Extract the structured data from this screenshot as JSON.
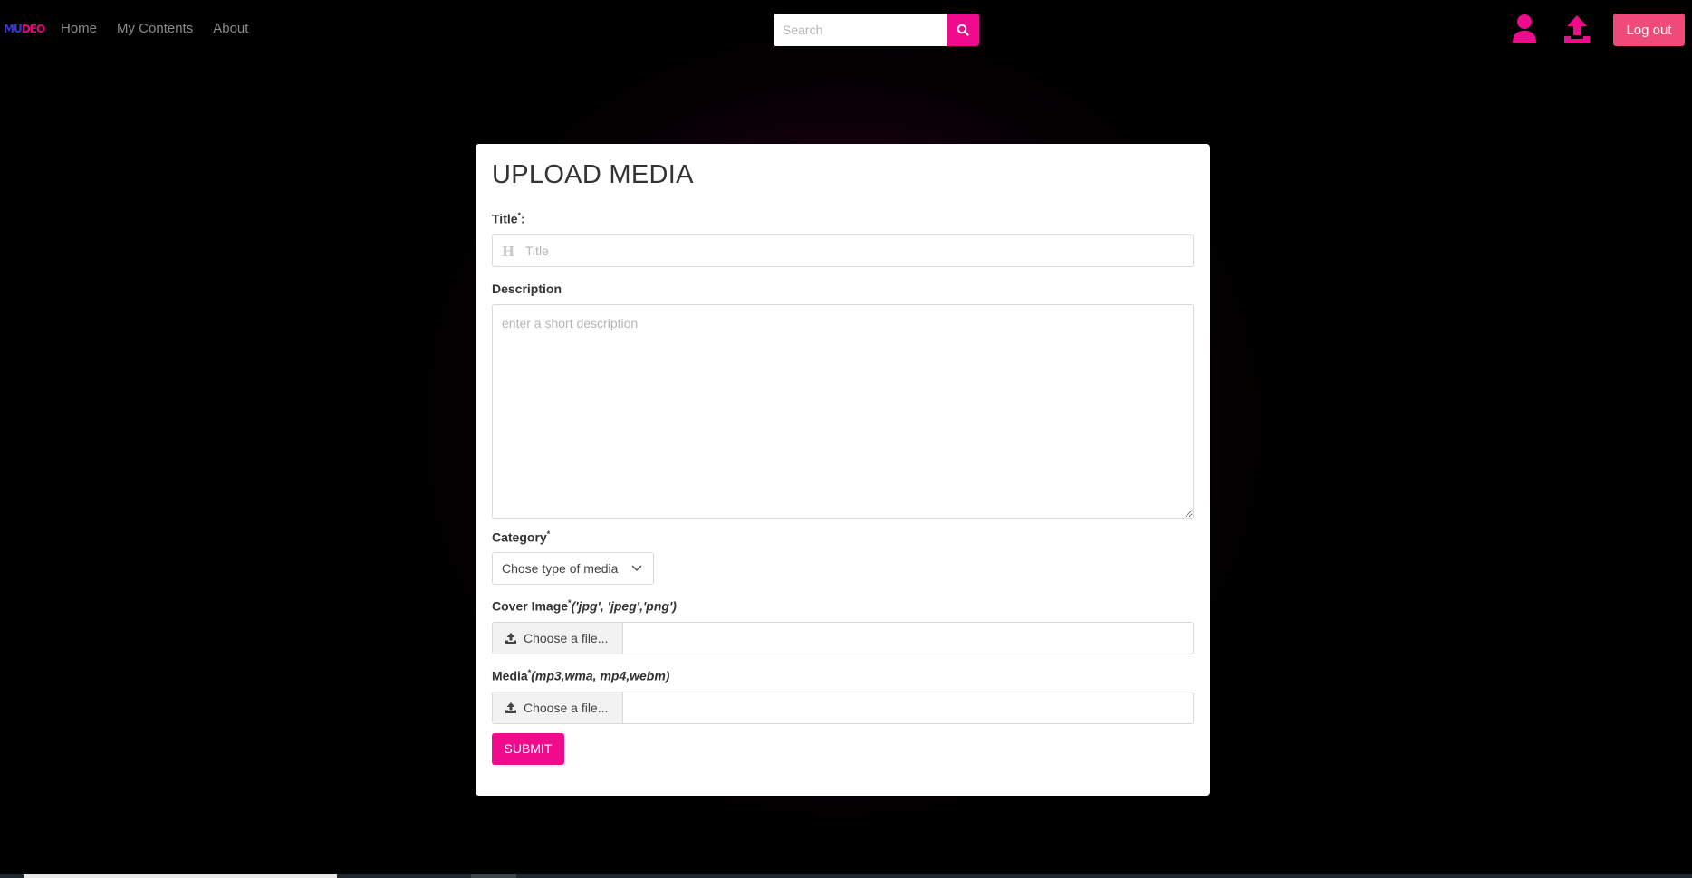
{
  "brand": {
    "logo_part1": "MU",
    "logo_part2": "DEO"
  },
  "nav": {
    "links": [
      {
        "label": "Home"
      },
      {
        "label": "My Contents"
      },
      {
        "label": "About"
      }
    ]
  },
  "search": {
    "placeholder": "Search"
  },
  "header_actions": {
    "logout_label": "Log out"
  },
  "colors": {
    "accent": "#ee0c8d",
    "logout": "#f04a78",
    "background": "#000000"
  },
  "form": {
    "heading": "UPLOAD MEDIA",
    "title_field": {
      "label": "Title",
      "required_mark": "*",
      "suffix": ":",
      "placeholder": "Title",
      "value": ""
    },
    "description_field": {
      "label": "Description",
      "placeholder": "enter a short description",
      "value": ""
    },
    "category_field": {
      "label": "Category",
      "required_mark": "*",
      "selected": "Chose type of media"
    },
    "cover_image_field": {
      "label": "Cover Image",
      "required_mark": "*",
      "formats": "('jpg', 'jpeg','png')",
      "button_label": "Choose a file...",
      "file_name": ""
    },
    "media_field": {
      "label": "Media",
      "required_mark": "*",
      "formats": "(mp3,wma, mp4,webm)",
      "button_label": "Choose a file...",
      "file_name": ""
    },
    "submit_label": "SUBMIT"
  }
}
